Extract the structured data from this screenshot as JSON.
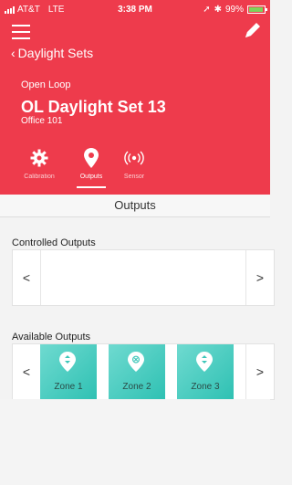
{
  "status_bar": {
    "carrier": "AT&T",
    "network": "LTE",
    "time": "3:38 PM",
    "battery": "99%",
    "battery_level": 0.99
  },
  "header": {
    "back_label": "Daylight Sets",
    "loop_type": "Open Loop",
    "title": "OL Daylight Set 13",
    "subtitle": "Office 101",
    "color": "#ee3b4c"
  },
  "tabs": [
    {
      "label": "Calibration",
      "icon": "gear-icon",
      "active": false
    },
    {
      "label": "Outputs",
      "icon": "location-pin-icon",
      "active": true
    },
    {
      "label": "Sensor",
      "icon": "broadcast-icon",
      "active": false
    }
  ],
  "section": {
    "title": "Outputs"
  },
  "controlled_outputs": {
    "label": "Controlled Outputs",
    "prev_label": "<",
    "next_label": ">"
  },
  "available_outputs": {
    "label": "Available Outputs",
    "prev_label": "<",
    "next_label": ">",
    "zones": [
      {
        "label": "Zone 1"
      },
      {
        "label": "Zone 2"
      },
      {
        "label": "Zone 3"
      }
    ],
    "zone_color": "#3cc6b8",
    "partial_color": "#f2a54c"
  }
}
